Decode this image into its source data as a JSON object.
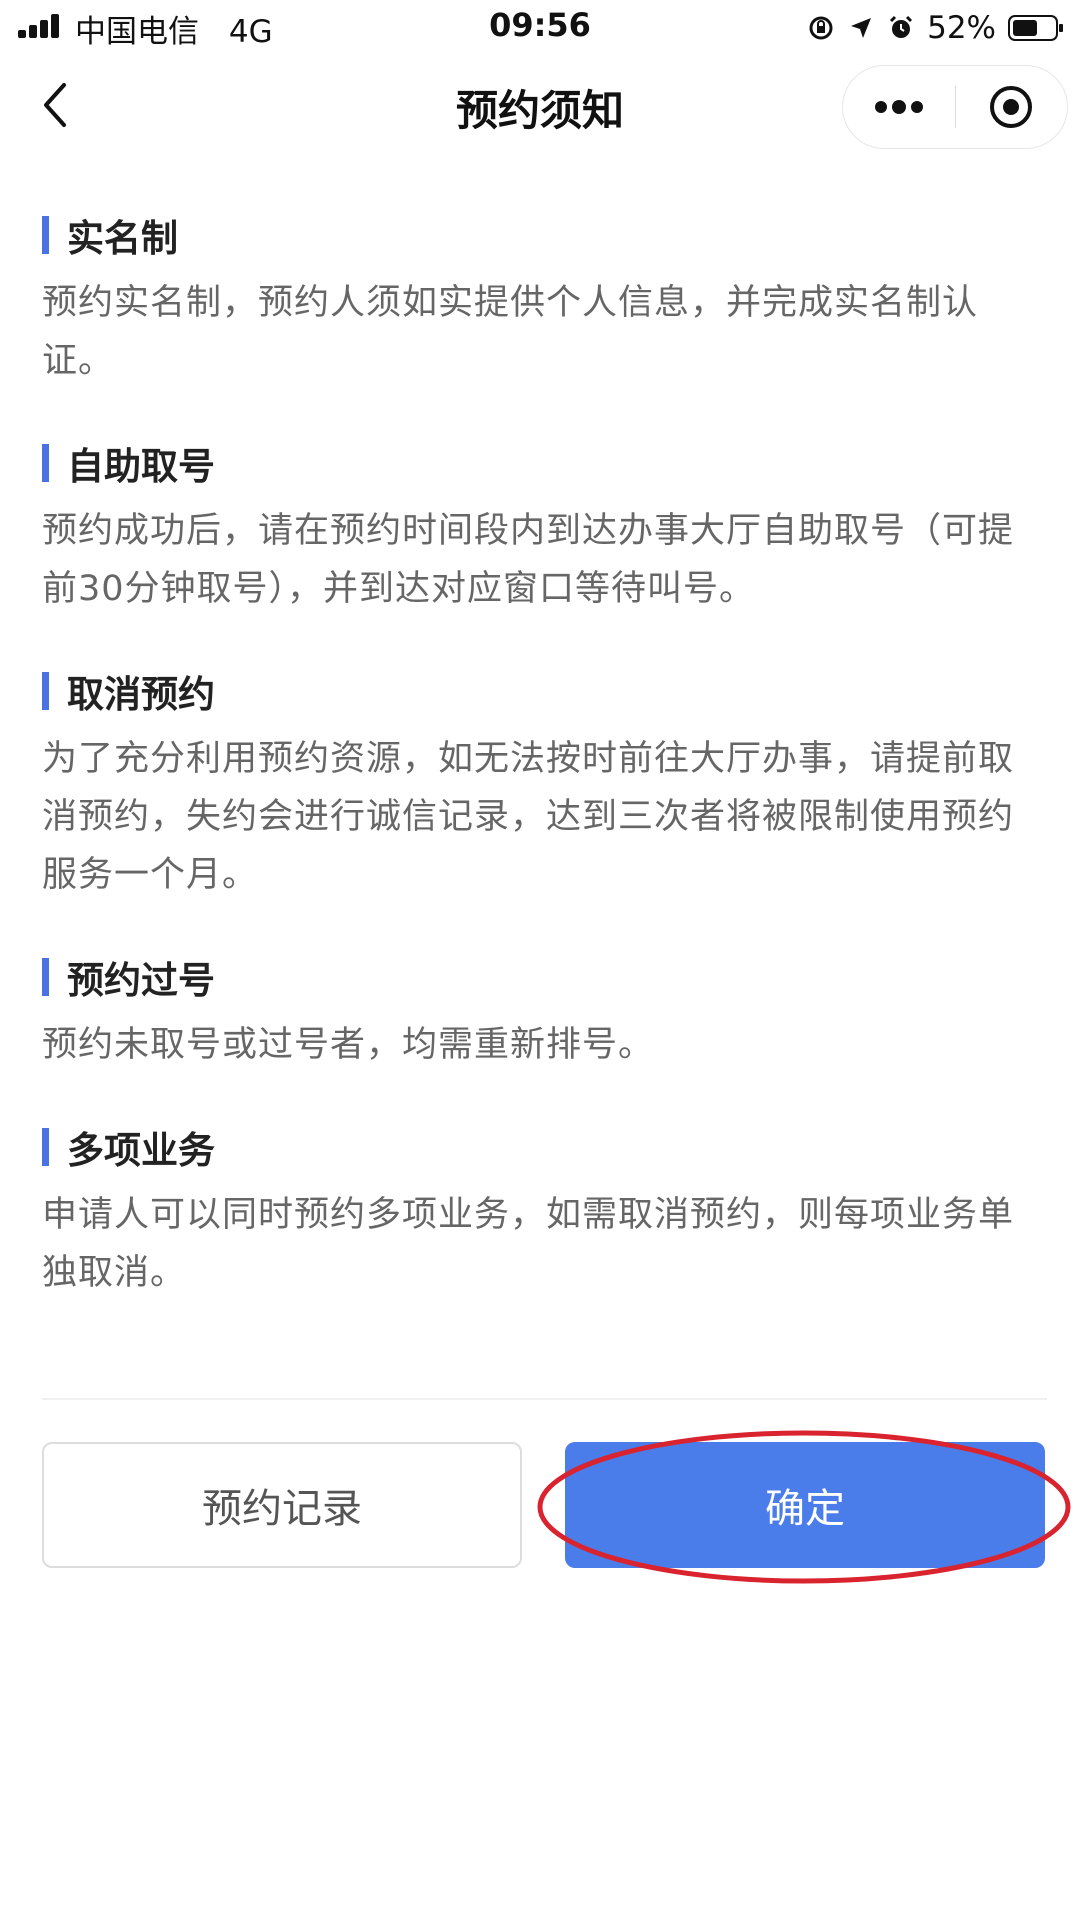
{
  "status_bar": {
    "carrier": "中国电信",
    "network": "4G",
    "time": "09:56",
    "battery_percent": "52%",
    "icons": [
      "signal-icon",
      "orientation-lock-icon",
      "location-icon",
      "alarm-icon",
      "battery-icon"
    ]
  },
  "nav": {
    "title": "预约须知",
    "back_icon": "chevron-left-icon",
    "more_icon": "more-dots-icon",
    "close_icon": "target-close-icon"
  },
  "sections": [
    {
      "title": "实名制",
      "body": "预约实名制，预约人须如实提供个人信息，并完成实名制认证。"
    },
    {
      "title": "自助取号",
      "body": "预约成功后，请在预约时间段内到达办事大厅自助取号（可提前30分钟取号），并到达对应窗口等待叫号。"
    },
    {
      "title": "取消预约",
      "body": "为了充分利用预约资源，如无法按时前往大厅办事，请提前取消预约，失约会进行诚信记录，达到三次者将被限制使用预约服务一个月。"
    },
    {
      "title": "预约过号",
      "body": "预约未取号或过号者，均需重新排号。"
    },
    {
      "title": "多项业务",
      "body": "申请人可以同时预约多项业务，如需取消预约，则每项业务单独取消。"
    }
  ],
  "buttons": {
    "records_label": "预约记录",
    "confirm_label": "确定"
  },
  "colors": {
    "accent": "#4a7cea",
    "heading_bar": "#4a72e0",
    "highlight": "#d9232e"
  }
}
